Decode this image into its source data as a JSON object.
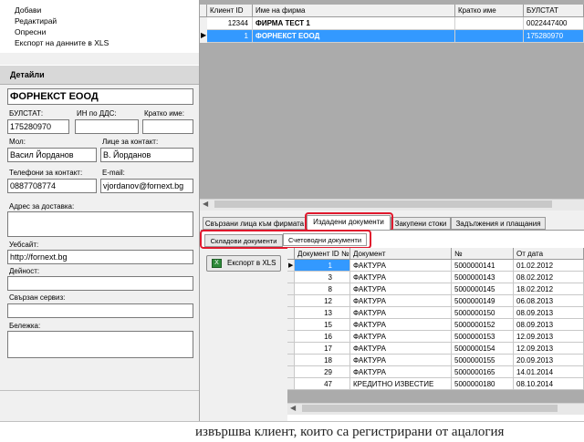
{
  "menu": {
    "items": [
      "Добави",
      "Редактирай",
      "Опресни",
      "Експорт на данните в XLS"
    ]
  },
  "details": {
    "header": "Детайли",
    "company_name": "ФОРНЕКСТ ЕООД",
    "bulstat_label": "БУЛСТАТ:",
    "bulstat": "175280970",
    "vat_label": "ИН по ДДС:",
    "vat": "",
    "short_label": "Кратко име:",
    "short": "",
    "mol_label": "Мол:",
    "mol": "Васил Йорданов",
    "contact_label": "Лице за контакт:",
    "contact": "В. Йорданов",
    "phone_label": "Телефони за контакт:",
    "phone": "0887708774",
    "email_label": "E-mail:",
    "email": "vjordanov@fornext.bg",
    "delivery_label": "Адрес за доставка:",
    "delivery": "",
    "website_label": "Уебсайт:",
    "website": "http://fornext.bg",
    "activity_label": "Дейност:",
    "activity": "",
    "service_label": "Свързан сервиз:",
    "service": "",
    "note_label": "Бележка:",
    "note": ""
  },
  "clients_grid": {
    "columns": [
      "Клиент ID",
      "Име на фирма",
      "Кратко име",
      "БУЛСТАТ"
    ],
    "rows": [
      {
        "id": "12344",
        "name": "ФИРМА ТЕСТ 1",
        "short": "",
        "bulstat": "0022447400"
      },
      {
        "id": "1",
        "name": "ФОРНЕКСТ ЕООД",
        "short": "",
        "bulstat": "175280970"
      }
    ]
  },
  "tabs": [
    "Свързани лица към фирмата",
    "Издадени документи",
    "Закупени стоки",
    "Задължения и плащания"
  ],
  "subtabs": [
    "Складови документи",
    "Счетоводни документи"
  ],
  "export_button": "Експорт в XLS",
  "docs_grid": {
    "columns": [
      "Документ ID",
      "№",
      "Документ",
      "№",
      "От дата"
    ],
    "rows": [
      {
        "id": "1",
        "doc": "ФАКТУРА",
        "num": "5000000141",
        "date": "01.02.2012"
      },
      {
        "id": "3",
        "doc": "ФАКТУРА",
        "num": "5000000143",
        "date": "08.02.2012"
      },
      {
        "id": "8",
        "doc": "ФАКТУРА",
        "num": "5000000145",
        "date": "18.02.2012"
      },
      {
        "id": "12",
        "doc": "ФАКТУРА",
        "num": "5000000149",
        "date": "06.08.2013"
      },
      {
        "id": "13",
        "doc": "ФАКТУРА",
        "num": "5000000150",
        "date": "08.09.2013"
      },
      {
        "id": "15",
        "doc": "ФАКТУРА",
        "num": "5000000152",
        "date": "08.09.2013"
      },
      {
        "id": "16",
        "doc": "ФАКТУРА",
        "num": "5000000153",
        "date": "12.09.2013"
      },
      {
        "id": "17",
        "doc": "ФАКТУРА",
        "num": "5000000154",
        "date": "12.09.2013"
      },
      {
        "id": "18",
        "doc": "ФАКТУРА",
        "num": "5000000155",
        "date": "20.09.2013"
      },
      {
        "id": "29",
        "doc": "ФАКТУРА",
        "num": "5000000165",
        "date": "14.01.2014"
      },
      {
        "id": "47",
        "doc": "КРЕДИТНО ИЗВЕСТИЕ",
        "num": "5000000180",
        "date": "08.10.2014"
      }
    ]
  },
  "bottom_text": "извършва клиент, които са регистрирани от ацалогия"
}
